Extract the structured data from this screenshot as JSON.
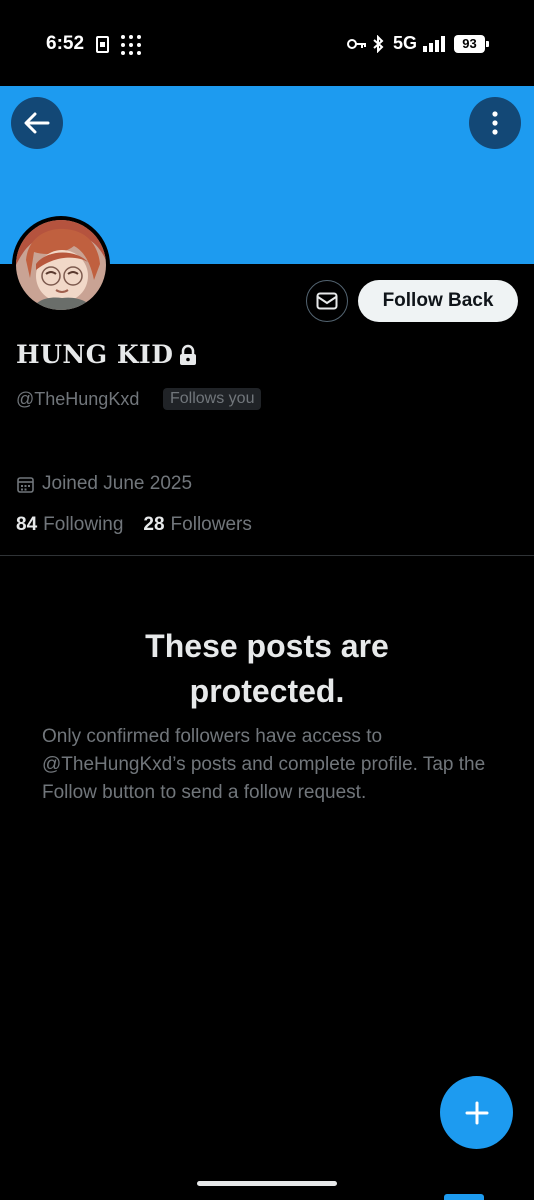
{
  "status_bar": {
    "time": "6:52",
    "network": "5G",
    "battery": "93"
  },
  "profile": {
    "display_name": "HUNG KID",
    "handle": "@TheHungKxd",
    "follows_you_badge": "Follows you",
    "joined": "Joined June 2025",
    "following_count": "84",
    "following_label": "Following",
    "followers_count": "28",
    "followers_label": "Followers",
    "protected": true
  },
  "actions": {
    "follow_back_label": "Follow Back",
    "message_icon": "envelope-icon",
    "back_icon": "arrow-left-icon",
    "more_icon": "vertical-dots-icon",
    "compose_icon": "plus-icon"
  },
  "protected_notice": {
    "title": "These posts are protected.",
    "body": "Only confirmed followers have access to @TheHungKxd’s posts and complete profile. Tap the Follow button to send a follow request."
  },
  "colors": {
    "banner": "#1d9bf0",
    "background": "#000000",
    "accent": "#1d9bf0",
    "secondary_text": "#71767b",
    "primary_text": "#e7e9ea"
  }
}
